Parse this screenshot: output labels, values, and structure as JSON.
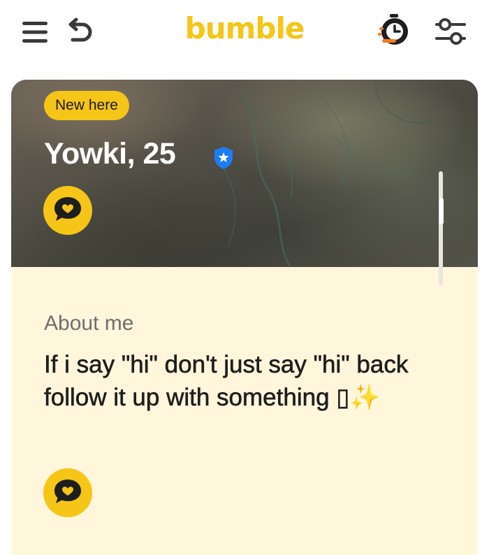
{
  "app": {
    "logo": "bumble",
    "brand_color": "#f5c518"
  },
  "topbar": {
    "menu_icon": "hamburger-menu-icon",
    "undo_icon": "undo-icon",
    "timer_icon": "stopwatch-icon",
    "filter_icon": "filter-sliders-icon"
  },
  "profile": {
    "badge": "New here",
    "name_age": "Yowki, 25",
    "verified_icon": "verified-shield-icon",
    "compliment_icon": "chat-heart-icon"
  },
  "about": {
    "heading": "About me",
    "text": "If i say \"hi\" don't just say \"hi\" back follow it up with something ▯✨",
    "compliment_icon": "chat-heart-icon"
  },
  "colors": {
    "accent_yellow": "#f5c518",
    "card_background": "#fff6dc",
    "verified_blue": "#1e7cf2",
    "timer_orange": "#f57c1f"
  }
}
